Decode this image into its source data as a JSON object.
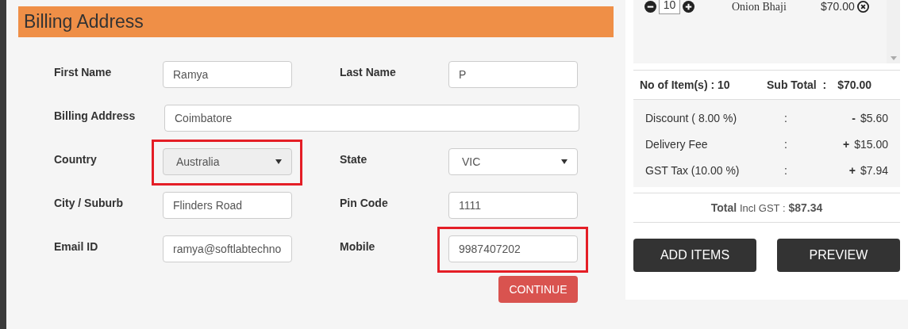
{
  "billing": {
    "title": "Billing Address",
    "rows": [
      {
        "fields": [
          {
            "label": "First Name",
            "kind": "input",
            "value": "Ramya",
            "highlighted": false
          },
          {
            "label": "Last Name",
            "kind": "input",
            "value": "P",
            "highlighted": false
          }
        ]
      },
      {
        "fields": [
          {
            "label": "Billing Address",
            "kind": "wide",
            "value": "Coimbatore",
            "highlighted": false
          }
        ]
      },
      {
        "fields": [
          {
            "label": "Country",
            "kind": "select",
            "value": "Australia",
            "disabled": true,
            "highlighted": true
          },
          {
            "label": "State",
            "kind": "select",
            "value": "VIC",
            "disabled": false,
            "highlighted": false
          }
        ]
      },
      {
        "fields": [
          {
            "label": "City / Suburb",
            "kind": "input",
            "value": "Flinders Road",
            "highlighted": false
          },
          {
            "label": "Pin Code",
            "kind": "input",
            "value": "1111",
            "highlighted": false
          }
        ]
      },
      {
        "fields": [
          {
            "label": "Email ID",
            "kind": "input",
            "value": "ramya@softlabtechno",
            "highlighted": false
          },
          {
            "label": "Mobile",
            "kind": "input",
            "value": "9987407202",
            "highlighted": true
          }
        ]
      }
    ],
    "continue_button": "CONTINUE"
  },
  "cart": {
    "items": [
      {
        "quantity": "10",
        "name": "Onion Bhaji",
        "price": "$70.00"
      }
    ],
    "item_count": "No of Item(s) : 10",
    "subtotal_label": "Sub Total  :",
    "subtotal": "$70.00",
    "charges": [
      {
        "label": "Discount ( 8.00 %)",
        "separator": ":",
        "sign": "-",
        "amount": "$5.60"
      },
      {
        "label": "Delivery Fee",
        "separator": ":",
        "sign": "+",
        "amount": "$15.00"
      },
      {
        "label": "GST Tax (10.00 %)",
        "separator": ":",
        "sign": "+",
        "amount": "$7.94"
      }
    ],
    "total_label": "Total",
    "total_qualifier": "Incl GST :",
    "total": "$87.34",
    "buttons": [
      "ADD ITEMS",
      "PREVIEW"
    ]
  }
}
